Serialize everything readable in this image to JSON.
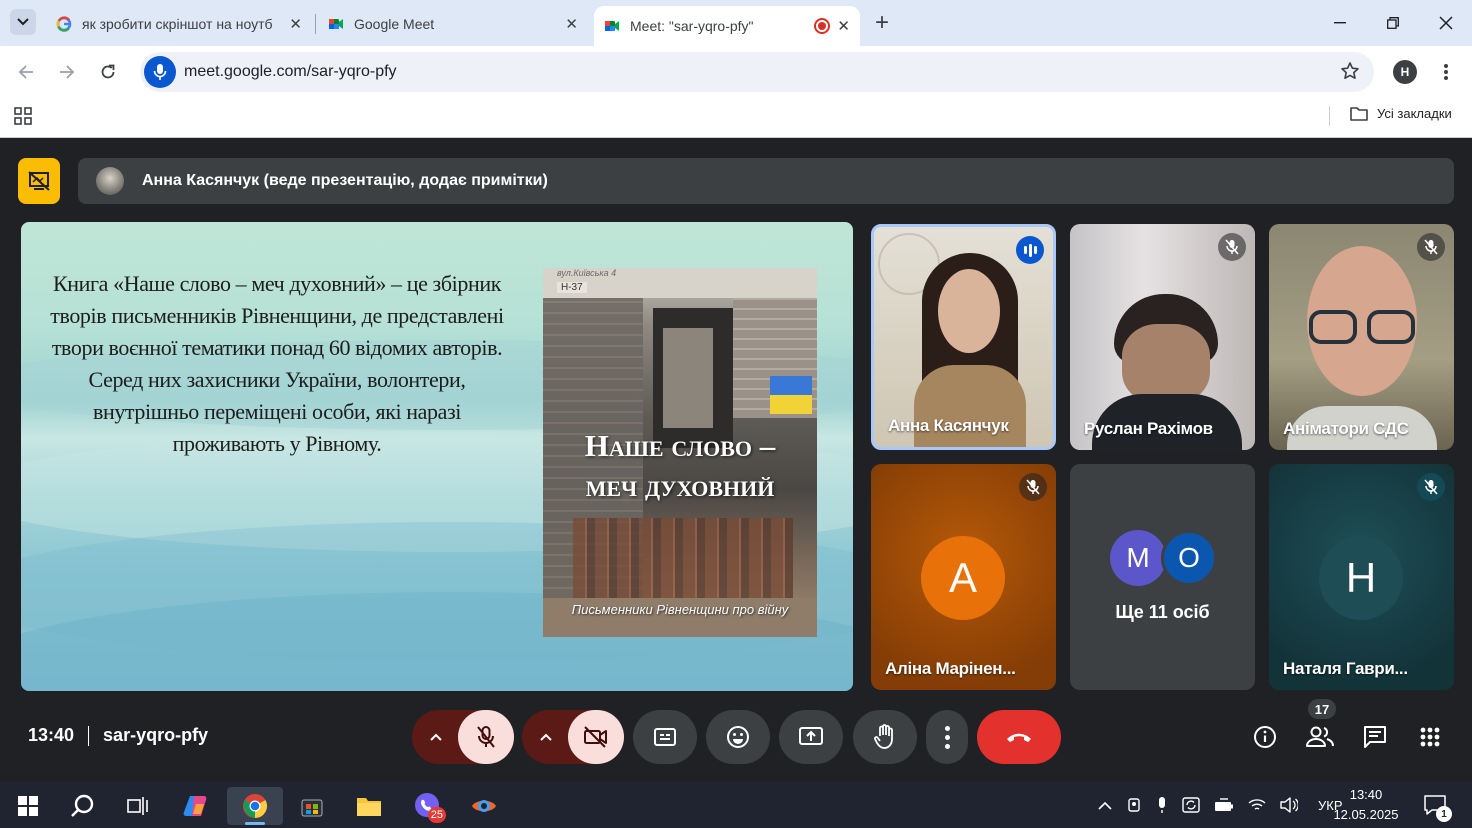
{
  "browser": {
    "tabs": [
      {
        "title": "як зробити скріншот на ноутб",
        "active": false
      },
      {
        "title": "Google Meet",
        "active": false
      },
      {
        "title": "Meet: \"sar-yqro-pfy\"",
        "active": true
      }
    ],
    "new_tab": "+",
    "url": "meet.google.com/sar-yqro-pfy",
    "profile_initial": "H",
    "bookmarks_label": "Усі закладки"
  },
  "meet": {
    "presenter_label": "Анна Касянчук (веде презентацію, додає примітки)",
    "slide": {
      "lines": [
        "Книга «Наше слово – меч духовний» – це збірник",
        "творів письменників Рівненщини, де представлені",
        "твори воєнної тематики понад 60 відомих авторів.",
        "Серед них захисники України, волонтери,",
        "внутрішньо переміщені особи, які наразі",
        "проживають у Рівному."
      ],
      "book_top_text": "вул.Київська 4",
      "book_sign": "Н-37",
      "book_title_1": "Наше слово –",
      "book_title_2": "меч духовний",
      "book_subtitle": "Письменники Рівненщини про війну"
    },
    "participants": [
      {
        "name": "Анна Касянчук",
        "state": "speaking"
      },
      {
        "name": "Руслан Рахімов",
        "state": "muted"
      },
      {
        "name": "Аніматори СДС",
        "state": "muted"
      },
      {
        "name": "Аліна Марінен...",
        "state": "muted",
        "avatar": "А",
        "color": "#e8710a"
      },
      {
        "name": "Ще 11 осіб",
        "avatars": [
          "М",
          "О"
        ],
        "colors": [
          "#5b56c9",
          "#0b57b0"
        ]
      },
      {
        "name": "Наталя Гаври...",
        "state": "muted",
        "avatar": "Н",
        "color": "#1e4d55"
      }
    ],
    "time": "13:40",
    "meeting_code": "sar-yqro-pfy",
    "people_count": "17",
    "end_color": "#e3322e"
  },
  "taskbar": {
    "viber_badge": "25",
    "language": "УКР",
    "clock_time": "13:40",
    "clock_date": "12.05.2025",
    "notification_count": "1"
  }
}
